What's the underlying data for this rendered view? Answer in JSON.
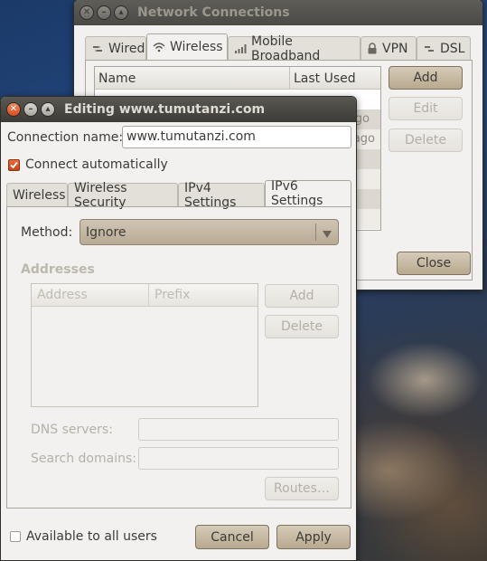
{
  "network_window": {
    "title": "Network Connections",
    "tabs": [
      {
        "label": "Wired",
        "icon": "wired-icon"
      },
      {
        "label": "Wireless",
        "icon": "wireless-icon"
      },
      {
        "label": "Mobile Broadband",
        "icon": "mobile-broadband-icon"
      },
      {
        "label": "VPN",
        "icon": "vpn-lock-icon"
      },
      {
        "label": "DSL",
        "icon": "dsl-icon"
      }
    ],
    "active_tab": "Wireless",
    "list_headers": {
      "name": "Name",
      "last_used": "Last Used"
    },
    "visible_last_used_fragments": [
      "go",
      "ago"
    ],
    "buttons": {
      "add": "Add",
      "edit": "Edit",
      "delete": "Delete",
      "close": "Close"
    }
  },
  "edit_window": {
    "title": "Editing www.tumutanzi.com",
    "connection_name_label": "Connection name:",
    "connection_name_value": "www.tumutanzi.com",
    "connect_automatically_label": "Connect automatically",
    "connect_automatically_checked": true,
    "tabs": [
      "Wireless",
      "Wireless Security",
      "IPv4 Settings",
      "IPv6 Settings"
    ],
    "active_tab": "IPv6 Settings",
    "method_label": "Method:",
    "method_value": "Ignore",
    "addresses_heading": "Addresses",
    "address_columns": [
      "Address",
      "Prefix"
    ],
    "address_buttons": {
      "add": "Add",
      "delete": "Delete"
    },
    "dns_servers_label": "DNS servers:",
    "search_domains_label": "Search domains:",
    "routes_button": "Routes…",
    "available_to_all_label": "Available to all users",
    "available_to_all_checked": false,
    "cancel_button": "Cancel",
    "apply_button": "Apply"
  },
  "colors": {
    "titlebar": "#3c3b37",
    "window_bg": "#f2f1ef",
    "close_button": "#dd4814",
    "accent_brown": "#b8a98f"
  }
}
